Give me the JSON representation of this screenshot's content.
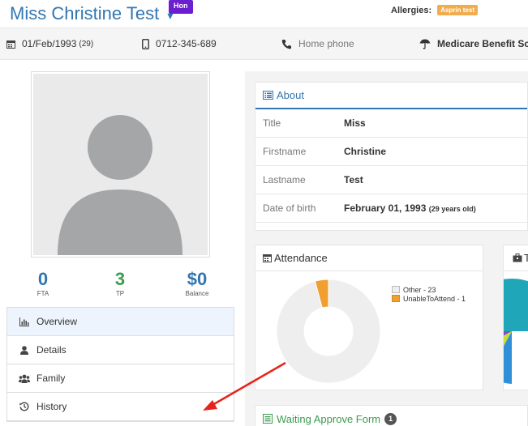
{
  "header": {
    "patient_name": "Miss Christine Test",
    "caret": "▾",
    "badge": "Hon",
    "allergies_label": "Allergies:",
    "allergy_value": "Asprin test"
  },
  "infobar": {
    "dob": "01/Feb/1993",
    "age": "(29)",
    "mobile": "0712-345-689",
    "home_phone_placeholder": "Home phone",
    "medicare": "Medicare Benefit Sc"
  },
  "stats": [
    {
      "value": "0",
      "label": "FTA"
    },
    {
      "value": "3",
      "label": "TP"
    },
    {
      "value": "$0",
      "label": "Balance"
    }
  ],
  "nav": [
    {
      "label": "Overview",
      "icon": "chart-icon"
    },
    {
      "label": "Details",
      "icon": "user-icon"
    },
    {
      "label": "Family",
      "icon": "group-icon"
    },
    {
      "label": "History",
      "icon": "history-icon"
    }
  ],
  "about": {
    "title": "About",
    "rows": [
      {
        "key": "Title",
        "value": "Miss",
        "extra": ""
      },
      {
        "key": "Firstname",
        "value": "Christine",
        "extra": ""
      },
      {
        "key": "Lastname",
        "value": "Test",
        "extra": ""
      },
      {
        "key": "Date of birth",
        "value": "February 01, 1993",
        "extra": "(29 years old)"
      }
    ]
  },
  "attendance": {
    "title": "Attendance",
    "legend": [
      {
        "label": "Other - 23",
        "color": "#eeeeee"
      },
      {
        "label": "UnableToAttend - 1",
        "color": "#f0a030"
      }
    ]
  },
  "tp_card": {
    "title": "T"
  },
  "waiting": {
    "title": "Waiting Approve Form",
    "count": "1"
  },
  "colors": {
    "primary": "#3276b1",
    "green": "#3a9c4d",
    "hon_badge": "#6a1fd0",
    "allergy_badge": "#f0ad4e",
    "arrow": "#e8231c"
  },
  "chart_data": {
    "type": "pie",
    "categories": [
      "Other",
      "UnableToAttend"
    ],
    "values": [
      23,
      1
    ]
  }
}
